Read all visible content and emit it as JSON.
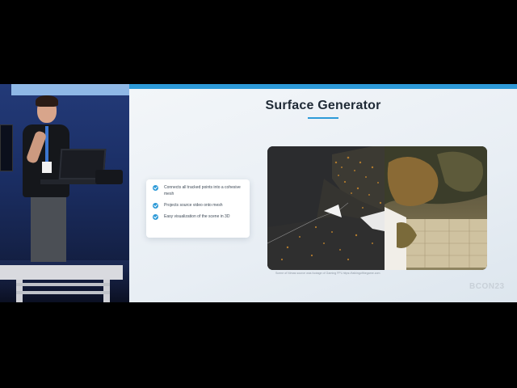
{
  "slide": {
    "title": "Surface Generator",
    "bullets": [
      "Connects all tracked points into a cohesive mesh",
      "Projects source video onto mesh",
      "Easy visualization of the scene in 3D"
    ],
    "caption": "Scene of Nimas source was footage of Gaming FPL https://taikingofthegame.com",
    "watermark": "BCON23"
  },
  "colors": {
    "accent": "#2d9ad8",
    "title": "#1f2a36",
    "slide_bg": "#eef2f6",
    "letterbox": "#000000"
  },
  "icons": {
    "bullet": "check-circle-icon"
  }
}
